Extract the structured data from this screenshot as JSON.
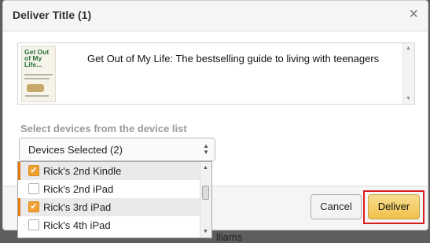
{
  "background": {
    "partial_text": "lliams"
  },
  "dialog": {
    "title": "Deliver Title (1)",
    "close_glyph": "×",
    "book": {
      "title": "Get Out of My Life: The bestselling guide to living with teenagers",
      "cover_text": "Get Out of My Life..."
    },
    "select_label": "Select devices from the device list",
    "select_value": "Devices Selected (2)",
    "devices": [
      {
        "label": "Rick's 2nd Kindle",
        "checked": true
      },
      {
        "label": "Rick's 2nd iPad",
        "checked": false
      },
      {
        "label": "Rick's 3rd iPad",
        "checked": true
      },
      {
        "label": "Rick's 4th iPad",
        "checked": false
      }
    ],
    "buttons": {
      "cancel": "Cancel",
      "deliver": "Deliver"
    }
  },
  "colors": {
    "accent_orange": "#f0a030",
    "deliver_yellow": "#f0c14b",
    "highlight_red": "#d91d1d"
  }
}
